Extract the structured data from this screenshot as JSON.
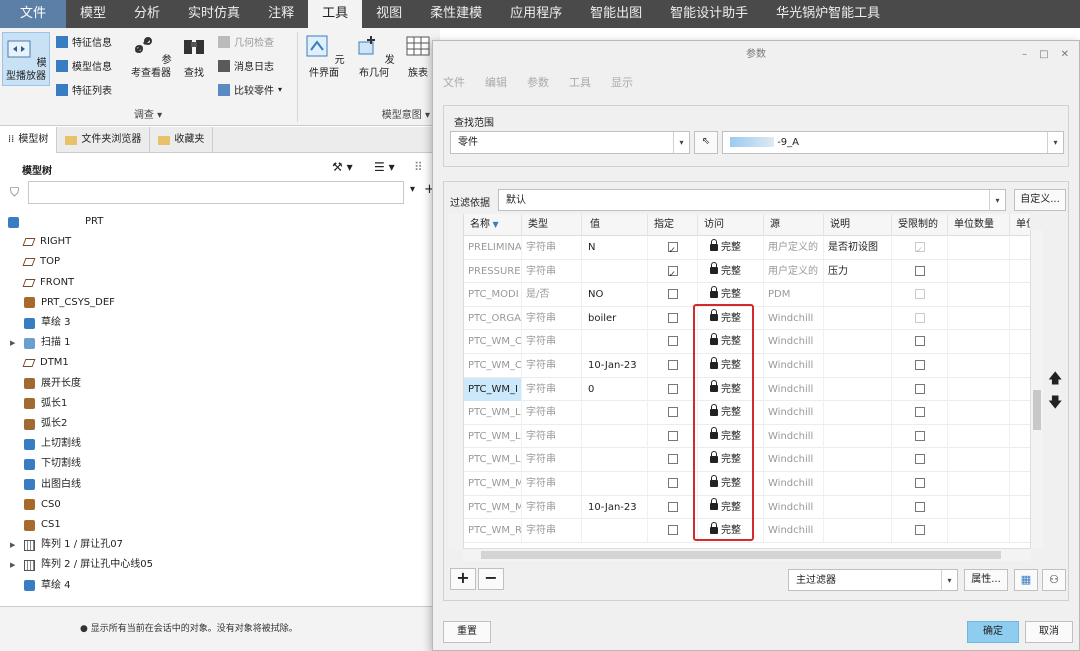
{
  "ribbon": {
    "tabs": [
      "文件",
      "模型",
      "分析",
      "实时仿真",
      "注释",
      "工具",
      "视图",
      "柔性建模",
      "应用程序",
      "智能出图",
      "智能设计助手",
      "华光锅炉智能工具"
    ],
    "active_tab": "工具",
    "groups": {
      "investigate": {
        "label": "调查 ▾",
        "player": "模型播放器",
        "feature_info": "特征信息",
        "model_info": "模型信息",
        "feature_list": "特征列表",
        "reference_viewer": "参考查看器",
        "find": "查找",
        "geometry_check": "几何检查",
        "message_log": "消息日志",
        "compare_part": "比较零件"
      },
      "model_intent": {
        "label": "模型意图 ▾",
        "component_interface": "元件界面",
        "publish_geometry": "发布几何",
        "family_table": "族表"
      }
    }
  },
  "left_panel": {
    "tabs": [
      "模型树",
      "文件夹浏览器",
      "收藏夹"
    ],
    "tree_title": "模型树",
    "tree_items": [
      {
        "label": "PRT",
        "icon": "part-icon"
      },
      {
        "label": "RIGHT",
        "icon": "plane-icon"
      },
      {
        "label": "TOP",
        "icon": "plane-icon"
      },
      {
        "label": "FRONT",
        "icon": "plane-icon"
      },
      {
        "label": "PRT_CSYS_DEF",
        "icon": "csys-icon"
      },
      {
        "label": "草绘 3",
        "icon": "sketch-icon"
      },
      {
        "label": "扫描 1",
        "icon": "sweep-icon",
        "expandable": true
      },
      {
        "label": "DTM1",
        "icon": "plane-icon"
      },
      {
        "label": "展开长度",
        "icon": "param-icon"
      },
      {
        "label": "弧长1",
        "icon": "param-icon"
      },
      {
        "label": "弧长2",
        "icon": "param-icon"
      },
      {
        "label": "上切割线",
        "icon": "sketch-icon"
      },
      {
        "label": "下切割线",
        "icon": "sketch-icon"
      },
      {
        "label": "出图白线",
        "icon": "sketch-icon"
      },
      {
        "label": "CS0",
        "icon": "csys-icon"
      },
      {
        "label": "CS1",
        "icon": "csys-icon"
      },
      {
        "label": "阵列 1 / 屏让孔07",
        "icon": "pattern-icon",
        "expandable": true
      },
      {
        "label": "阵列 2 / 屏让孔中心线05",
        "icon": "pattern-icon",
        "expandable": true
      },
      {
        "label": "草绘 4",
        "icon": "sketch-icon"
      }
    ],
    "status": "显示所有当前在会话中的对象。没有对象将被拭除。"
  },
  "dialog": {
    "title": "参数",
    "menu": [
      "文件",
      "编辑",
      "参数",
      "工具",
      "显示"
    ],
    "scope_label": "查找范围",
    "scope_type": "零件",
    "scope_object": "-9_A",
    "filter_label": "过滤依据",
    "filter_value": "默认",
    "custom_button": "自定义...",
    "columns": [
      "名称",
      "类型",
      "值",
      "指定",
      "访问",
      "源",
      "说明",
      "受限制的",
      "单位数量",
      "单位"
    ],
    "rows": [
      {
        "name": "PRELIMINA",
        "type": "字符串",
        "value": "N",
        "designate": true,
        "access": "完整",
        "source": "用户定义的",
        "desc": "是否初设图",
        "restricted": true,
        "restricted_disabled": true
      },
      {
        "name": "PRESSURE",
        "type": "字符串",
        "value": "",
        "designate": true,
        "access": "完整",
        "source": "用户定义的",
        "desc": "压力",
        "restricted": false
      },
      {
        "name": "PTC_MODI",
        "type": "是/否",
        "value": "NO",
        "designate": false,
        "access": "完整",
        "source": "PDM",
        "desc": "",
        "restricted": false,
        "restricted_disabled": true
      },
      {
        "name": "PTC_ORGA",
        "type": "字符串",
        "value": "boiler",
        "designate": false,
        "access": "完整",
        "source": "Windchill",
        "desc": "",
        "restricted": false,
        "restricted_disabled": true
      },
      {
        "name": "PTC_WM_C",
        "type": "字符串",
        "value": "",
        "designate": false,
        "access": "完整",
        "source": "Windchill",
        "desc": "",
        "restricted": false
      },
      {
        "name": "PTC_WM_C",
        "type": "字符串",
        "value": "10-Jan-23",
        "designate": false,
        "access": "完整",
        "source": "Windchill",
        "desc": "",
        "restricted": false
      },
      {
        "name": "PTC_WM_I",
        "type": "字符串",
        "value": "0",
        "designate": false,
        "access": "完整",
        "source": "Windchill",
        "desc": "",
        "restricted": false,
        "selected": true
      },
      {
        "name": "PTC_WM_L",
        "type": "字符串",
        "value": "",
        "designate": false,
        "access": "完整",
        "source": "Windchill",
        "desc": "",
        "restricted": false
      },
      {
        "name": "PTC_WM_L",
        "type": "字符串",
        "value": "",
        "designate": false,
        "access": "完整",
        "source": "Windchill",
        "desc": "",
        "restricted": false
      },
      {
        "name": "PTC_WM_L",
        "type": "字符串",
        "value": "",
        "designate": false,
        "access": "完整",
        "source": "Windchill",
        "desc": "",
        "restricted": false
      },
      {
        "name": "PTC_WM_M",
        "type": "字符串",
        "value": "",
        "designate": false,
        "access": "完整",
        "source": "Windchill",
        "desc": "",
        "restricted": false
      },
      {
        "name": "PTC_WM_M",
        "type": "字符串",
        "value": "10-Jan-23",
        "designate": false,
        "access": "完整",
        "source": "Windchill",
        "desc": "",
        "restricted": false
      },
      {
        "name": "PTC_WM_R",
        "type": "字符串",
        "value": "",
        "designate": false,
        "access": "完整",
        "source": "Windchill",
        "desc": "",
        "restricted": false
      }
    ],
    "main_filter": "主过滤器",
    "properties_button": "属性...",
    "reset_button": "重置",
    "ok_button": "确定",
    "cancel_button": "取消"
  },
  "colors": {
    "accent": "#8ecdf0",
    "highlight": "#d42a2a",
    "ribbon_dark": "#4a4a4a"
  }
}
